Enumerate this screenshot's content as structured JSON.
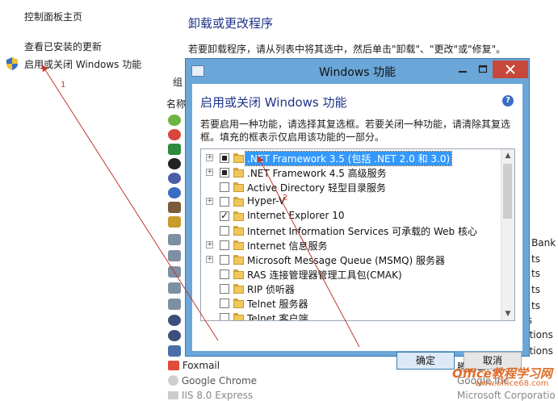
{
  "left_nav": {
    "home": "控制面板主页",
    "installed_updates": "查看已安装的更新",
    "windows_features": "启用或关闭 Windows 功能"
  },
  "main": {
    "title": "卸载或更改程序",
    "description": "若要卸载程序，请从列表中将其选中，然后单击\"卸载\"、\"更改\"或\"修复\"。",
    "toolbar_fragment": "组",
    "column_fragment": "名称",
    "programs": [
      {
        "name": "Foxmail"
      },
      {
        "name": "Google Chrome"
      },
      {
        "name": "IIS 8.0 Express"
      }
    ],
    "publisher_fragments": [
      "s Bank",
      "ts",
      "ts",
      "ts",
      "ts",
      "ts",
      "utions",
      "utions",
      "ution",
      "腾讯公司",
      "Google Inc.",
      "Microsoft Corporatio"
    ]
  },
  "dialog": {
    "window_title": "Windows 功能",
    "heading": "启用或关闭 Windows 功能",
    "description": "若要启用一种功能，请选择其复选框。若要关闭一种功能，请清除其复选框。填充的框表示仅启用该功能的一部分。",
    "features": [
      {
        "label": ".NET Framework 3.5 (包括 .NET 2.0 和 3.0)",
        "state": "partial",
        "expandable": true,
        "selected": true
      },
      {
        "label": ".NET Framework 4.5 高级服务",
        "state": "partial",
        "expandable": true,
        "selected": false
      },
      {
        "label": "Active Directory 轻型目录服务",
        "state": "unchecked",
        "expandable": false,
        "selected": false
      },
      {
        "label": "Hyper-V",
        "state": "unchecked",
        "expandable": true,
        "selected": false
      },
      {
        "label": "Internet Explorer 10",
        "state": "checked",
        "expandable": false,
        "selected": false
      },
      {
        "label": "Internet Information Services 可承载的 Web 核心",
        "state": "unchecked",
        "expandable": false,
        "selected": false
      },
      {
        "label": "Internet 信息服务",
        "state": "unchecked",
        "expandable": true,
        "selected": false
      },
      {
        "label": "Microsoft Message Queue (MSMQ) 服务器",
        "state": "unchecked",
        "expandable": true,
        "selected": false
      },
      {
        "label": "RAS 连接管理器管理工具包(CMAK)",
        "state": "unchecked",
        "expandable": false,
        "selected": false
      },
      {
        "label": "RIP 侦听器",
        "state": "unchecked",
        "expandable": false,
        "selected": false
      },
      {
        "label": "Telnet 服务器",
        "state": "unchecked",
        "expandable": false,
        "selected": false
      },
      {
        "label": "Telnet 客户端",
        "state": "unchecked",
        "expandable": false,
        "selected": false
      }
    ],
    "ok_label": "确定",
    "cancel_label": "取消",
    "help_glyph": "?"
  },
  "annotations": {
    "marker_1": "1",
    "marker_2": "2"
  },
  "watermark": {
    "line1": "Office教程学习网",
    "line2": "www.office68.com"
  },
  "colors": {
    "dialog_frame": "#6aa6d8",
    "close_button": "#c7483a",
    "heading_blue": "#1e3287",
    "selection": "#3399ff",
    "arrow": "#c0392b"
  }
}
